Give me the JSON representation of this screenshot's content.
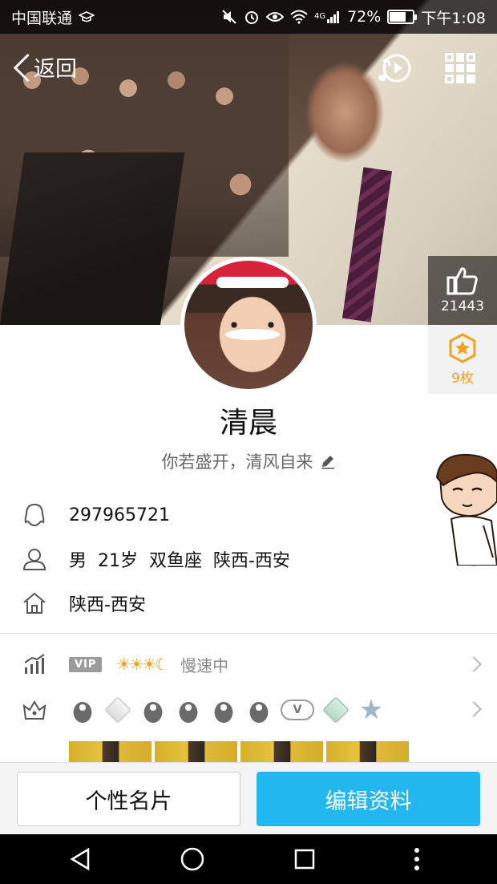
{
  "status_bar": {
    "carrier": "中国联通",
    "battery_level": "72%",
    "battery_fraction": 0.72,
    "network": "4G",
    "time": "下午1:08"
  },
  "header": {
    "back_label": "返回",
    "icons": [
      "music-play-icon",
      "qr-code-icon"
    ]
  },
  "stats": {
    "likes": "21443",
    "badges": "9枚"
  },
  "profile": {
    "name": "清晨",
    "motto": "你若盛开，清风自来",
    "qq_number": "297965721",
    "details": "男  21岁  双鱼座  陕西-西安",
    "hometown": "陕西-西安"
  },
  "vip": {
    "tag": "VIP",
    "level_icons": "☀☀☀☾",
    "status": "慢速中"
  },
  "badges_row": {
    "items": [
      "penguin-badge",
      "diamond-badge",
      "penguin-fish-badge",
      "penguin-gem-badge",
      "penguin-key-badge",
      "penguin-crown-badge",
      "cloud-v-badge",
      "green-diamond-badge",
      "star-badge"
    ],
    "cloud_letter": "V"
  },
  "actions": {
    "card_label": "个性名片",
    "edit_label": "编辑资料"
  },
  "colors": {
    "accent": "#23b7f0",
    "badge_gold": "#f3a21b"
  }
}
